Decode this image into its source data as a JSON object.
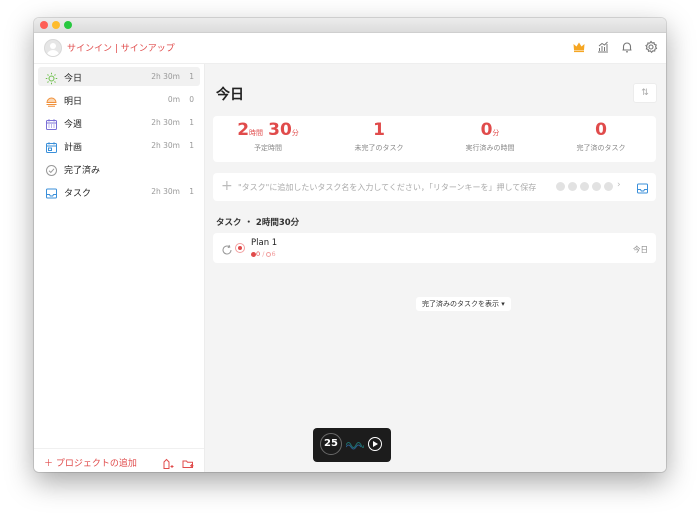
{
  "header": {
    "signin_label": "サインイン | サインアップ",
    "icons": [
      "crown-icon",
      "stats-icon",
      "bell-icon",
      "settings-icon"
    ],
    "accent_color": "#e04b4b"
  },
  "sidebar": {
    "items": [
      {
        "label": "今日",
        "time": "2h 30m",
        "count": "1",
        "icon": "sun-icon",
        "active": true
      },
      {
        "label": "明日",
        "time": "0m",
        "count": "0",
        "icon": "sunset-icon",
        "active": false
      },
      {
        "label": "今週",
        "time": "2h 30m",
        "count": "1",
        "icon": "calendar-week-icon",
        "active": false
      },
      {
        "label": "計画",
        "time": "2h 30m",
        "count": "1",
        "icon": "calendar-plan-icon",
        "active": false
      },
      {
        "label": "完了済み",
        "time": "",
        "count": "",
        "icon": "check-circle-icon",
        "active": false
      },
      {
        "label": "タスク",
        "time": "2h 30m",
        "count": "1",
        "icon": "inbox-icon",
        "active": false
      }
    ],
    "add_project_label": "＋ プロジェクトの追加"
  },
  "main": {
    "title": "今日",
    "stats": [
      {
        "parts": [
          {
            "v": "2",
            "u": "時間"
          },
          {
            "v": "30",
            "u": "分"
          }
        ],
        "label": "予定時間"
      },
      {
        "parts": [
          {
            "v": "1",
            "u": ""
          }
        ],
        "label": "未完了のタスク"
      },
      {
        "parts": [
          {
            "v": "0",
            "u": "分"
          }
        ],
        "label": "実行済みの時間"
      },
      {
        "parts": [
          {
            "v": "0",
            "u": ""
          }
        ],
        "label": "完了済のタスク"
      }
    ],
    "add_task_placeholder": "\"タスク\"に追加したいタスク名を入力してください，「リターンキーを」押して保存",
    "section_header": "タスク ・ 2時間30分",
    "tasks": [
      {
        "name": "Plan 1",
        "done_pomos": "0",
        "total_pomos": "6",
        "date": "今日"
      }
    ],
    "show_completed_label": "完了済みのタスクを表示 ▾"
  },
  "timer": {
    "value": "25"
  }
}
